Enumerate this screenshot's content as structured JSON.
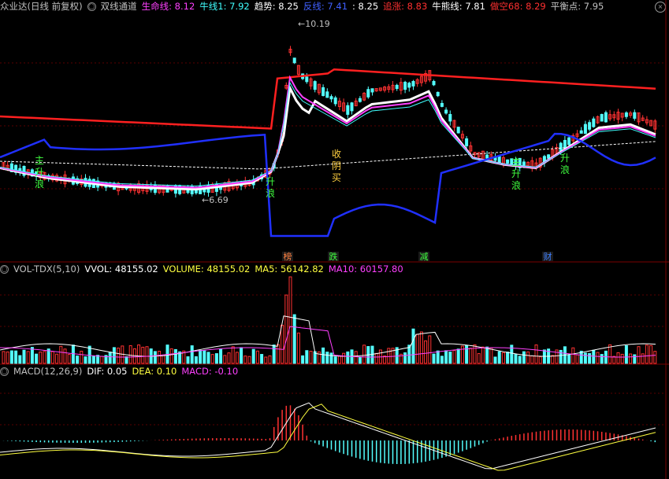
{
  "main_header": {
    "stock": "众业达(日线 前复权)",
    "indicator_icon": "settings-circle-icon",
    "indicator": "双线通道",
    "items": [
      {
        "label": "生命线: 8.12",
        "color": "#ff40ff"
      },
      {
        "label": "牛线1: 7.92",
        "color": "#40ffff"
      },
      {
        "label": "趋势: 8.25",
        "color": "#ffffff"
      },
      {
        "label": "反线: 7.41",
        "color": "#4060ff"
      },
      {
        "label": ": 8.25",
        "color": "#ffffff"
      },
      {
        "label": "追涨: 8.83",
        "color": "#ff3030"
      },
      {
        "label": "牛熊线: 7.81",
        "color": "#ffffff"
      },
      {
        "label": "做空68: 8.29",
        "color": "#ff3030"
      },
      {
        "label": "平衡点: 7.95",
        "color": "#c0c0c0"
      }
    ]
  },
  "vol_header": {
    "name": "VOL-TDX(5,10)",
    "vvol": "VVOL: 48155.02",
    "volume": "VOLUME: 48155.02",
    "ma5": "MA5: 56142.82",
    "ma10": "MA10: 60157.80"
  },
  "macd_header": {
    "name": "MACD(12,26,9)",
    "dif": "DIF: 0.05",
    "dea": "DEA: 0.10",
    "macd": "MACD: -0.10"
  },
  "price_labels": {
    "high": "10.19",
    "low": "6.69"
  },
  "signals": [
    {
      "text": "主升浪",
      "color": "#40ff40"
    },
    {
      "text": "升浪",
      "color": "#40ff40"
    },
    {
      "text": "收阴买",
      "color": "#ffd040"
    },
    {
      "text": "主升浪",
      "color": "#40ff40"
    },
    {
      "text": "升浪",
      "color": "#40ff40"
    }
  ],
  "event_tags": [
    "榜",
    "跌",
    "减",
    "财"
  ],
  "colors": {
    "up": "#ff3232",
    "down": "#54ffff",
    "bg": "#000000",
    "grid": "#5a0000",
    "border": "#7a0000"
  }
}
